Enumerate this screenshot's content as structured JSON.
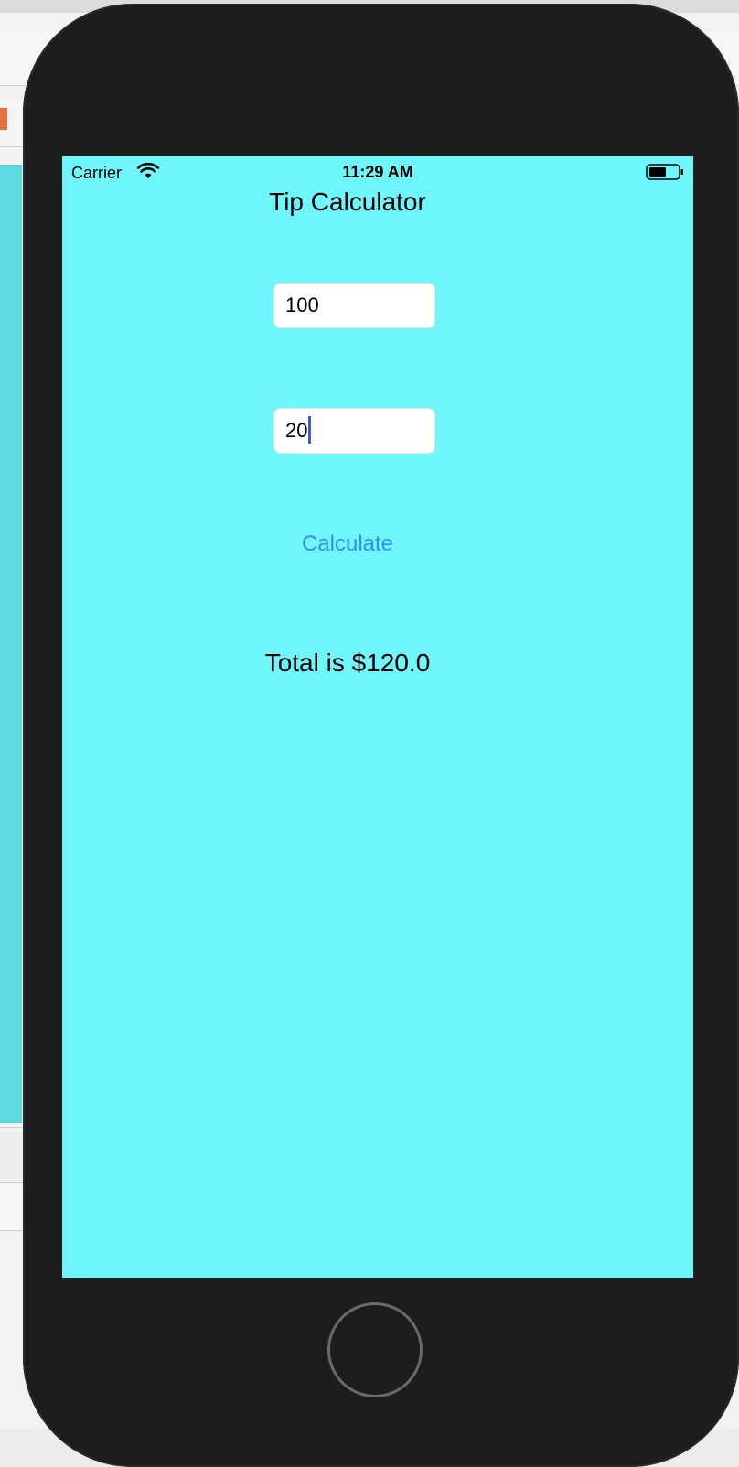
{
  "status_bar": {
    "carrier": "Carrier",
    "time": "11:29 AM"
  },
  "app": {
    "title": "Tip Calculator",
    "bill_field": {
      "value": "100"
    },
    "tip_field": {
      "value": "20"
    },
    "calculate_label": "Calculate",
    "total_text": "Total is $120.0",
    "colors": {
      "background": "#6ff6fa",
      "button_text": "#2f8ff0",
      "caret": "#3b5bd6"
    }
  },
  "icons": [
    "wifi-icon",
    "battery-icon",
    "home-button"
  ]
}
